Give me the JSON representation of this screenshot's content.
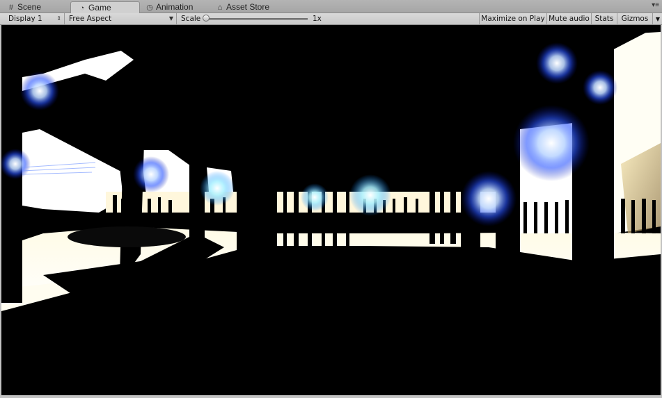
{
  "tabs": [
    {
      "label": "Scene",
      "icon": "grid-icon",
      "active": false
    },
    {
      "label": "Game",
      "icon": "pacman-icon",
      "active": true
    },
    {
      "label": "Animation",
      "icon": "clock-icon",
      "active": false
    },
    {
      "label": "Asset Store",
      "icon": "store-icon",
      "active": false
    }
  ],
  "toolbar": {
    "display": "Display 1",
    "aspect": "Free Aspect",
    "scale_label": "Scale",
    "scale_value": "1x",
    "maximize_on_play": "Maximize on Play",
    "mute_audio": "Mute audio",
    "stats": "Stats",
    "gizmos": "Gizmos"
  },
  "game_view": {
    "description_icon": "game-render-view"
  }
}
